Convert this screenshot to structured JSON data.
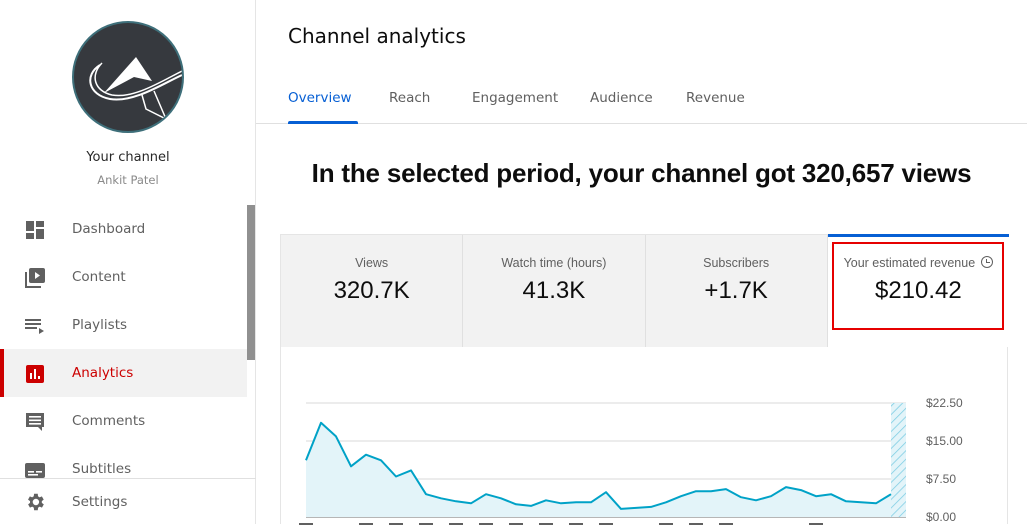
{
  "sidebar": {
    "channel_title": "Your channel",
    "channel_name": "Ankit Patel",
    "items": [
      {
        "label": "Dashboard",
        "icon": "dashboard-icon"
      },
      {
        "label": "Content",
        "icon": "content-icon"
      },
      {
        "label": "Playlists",
        "icon": "playlists-icon"
      },
      {
        "label": "Analytics",
        "icon": "analytics-icon",
        "active": true
      },
      {
        "label": "Comments",
        "icon": "comments-icon"
      },
      {
        "label": "Subtitles",
        "icon": "subtitles-icon"
      }
    ],
    "settings_label": "Settings"
  },
  "header": {
    "title": "Channel analytics",
    "tabs": [
      {
        "label": "Overview",
        "active": true
      },
      {
        "label": "Reach"
      },
      {
        "label": "Engagement"
      },
      {
        "label": "Audience"
      },
      {
        "label": "Revenue"
      }
    ]
  },
  "headline": "In the selected period, your channel got 320,657 views",
  "metrics": [
    {
      "label": "Views",
      "value": "320.7K"
    },
    {
      "label": "Watch time (hours)",
      "value": "41.3K"
    },
    {
      "label": "Subscribers",
      "value": "+1.7K"
    },
    {
      "label": "Your estimated revenue",
      "value": "$210.42",
      "selected": true,
      "icon": "clock-icon"
    }
  ],
  "colors": {
    "accent": "#065fd4",
    "active_nav": "#cc0000",
    "highlight_box": "#e60000",
    "line": "#00a2c7",
    "area": "#e3f4f9"
  },
  "chart_data": {
    "type": "area",
    "title": "",
    "xlabel": "",
    "ylabel": "Your estimated revenue",
    "ylim": [
      0,
      22.5
    ],
    "yticks": [
      "$22.50",
      "$15.00",
      "$7.50",
      "$0.00"
    ],
    "ytick_values": [
      22.5,
      15,
      7.5,
      0
    ],
    "grid": true,
    "y_axis_side": "right",
    "partial_last_period": true,
    "values": [
      11.2,
      18.6,
      15.9,
      10.0,
      12.3,
      11.2,
      8.0,
      9.2,
      4.5,
      3.7,
      3.1,
      2.7,
      4.5,
      3.7,
      2.5,
      2.2,
      3.3,
      2.7,
      2.9,
      2.9,
      4.9,
      1.6,
      1.8,
      2.0,
      2.9,
      4.1,
      5.1,
      5.1,
      5.5,
      3.9,
      3.3,
      4.1,
      5.9,
      5.3,
      4.1,
      4.5,
      3.1,
      2.9,
      2.7,
      4.5
    ]
  }
}
